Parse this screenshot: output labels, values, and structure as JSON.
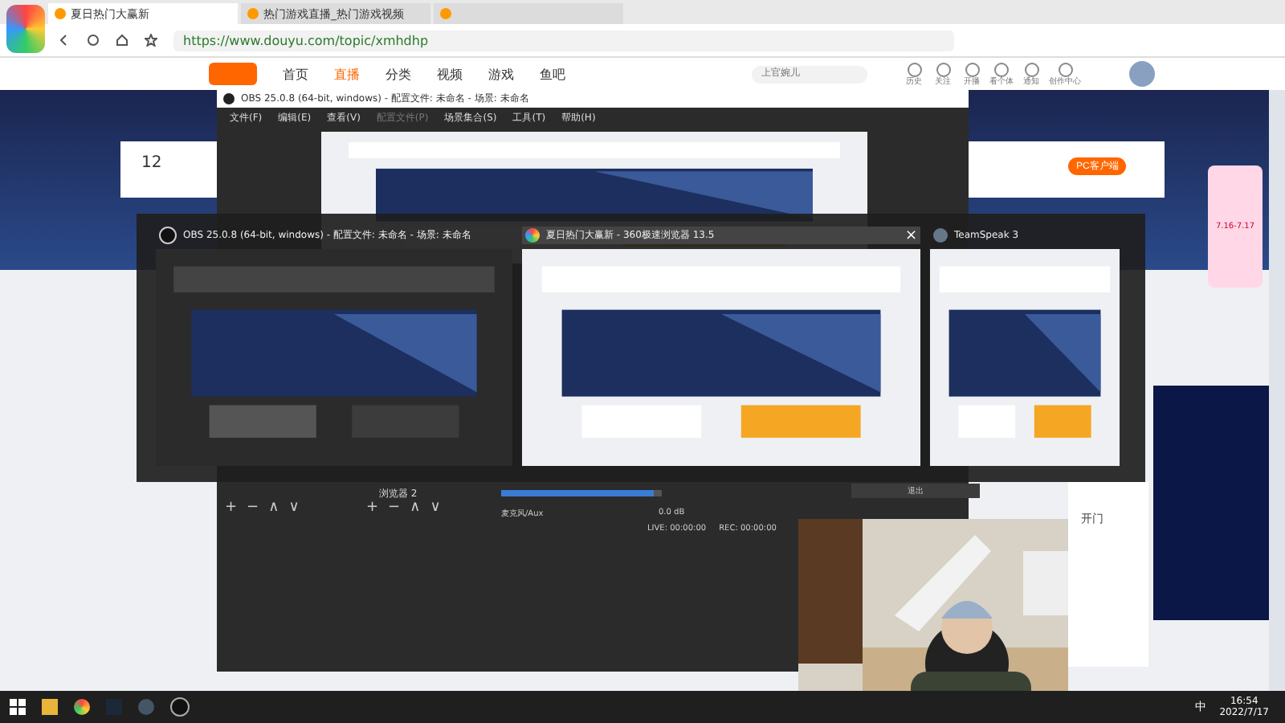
{
  "browser": {
    "tabs": [
      {
        "title": "夏日热门大赢新",
        "selected": true
      },
      {
        "title": "热门游戏直播_热门游戏视频",
        "selected": false
      },
      {
        "selected": false
      }
    ],
    "address": "https://www.douyu.com/topic/xmhdhp",
    "site_nav": [
      {
        "label": "首页",
        "selected": false
      },
      {
        "label": "直播",
        "selected": true
      },
      {
        "label": "分类",
        "selected": false
      },
      {
        "label": "视频",
        "selected": false
      },
      {
        "label": "游戏",
        "selected": false
      },
      {
        "label": "鱼吧",
        "selected": false
      }
    ],
    "site_search": {
      "placeholder": "上官婉儿"
    },
    "header_icons": [
      {
        "label": "历史"
      },
      {
        "label": "关注"
      },
      {
        "label": "开播"
      },
      {
        "label": "看个体"
      },
      {
        "label": "通知"
      },
      {
        "label": "创作中心"
      }
    ],
    "left_stat": "12",
    "pc_button": "PC客户端",
    "promo": "7.16-7.17",
    "chat_line": "开门"
  },
  "obs": {
    "title": "OBS 25.0.8 (64-bit, windows) - 配置文件: 未命名 - 场景: 未命名",
    "menu": [
      {
        "label": "文件(F)",
        "disabled": false
      },
      {
        "label": "编辑(E)",
        "disabled": false
      },
      {
        "label": "查看(V)",
        "disabled": false
      },
      {
        "label": "配置文件(P)",
        "disabled": true
      },
      {
        "label": "场景集合(S)",
        "disabled": false
      },
      {
        "label": "工具(T)",
        "disabled": false
      },
      {
        "label": "帮助(H)",
        "disabled": false
      }
    ],
    "source": "浏览器 2",
    "scene_controls": [
      "+",
      "−",
      "∧",
      "∨"
    ],
    "source_controls": [
      "+",
      "−",
      "∧",
      "∨"
    ],
    "volume": {
      "level": 0.95
    },
    "mic": "麦克风/Aux",
    "db": "0.0 dB",
    "live": "LIVE: 00:00:00",
    "rec": "REC: 00:00:00",
    "exit": "退出"
  },
  "switcher": [
    {
      "title": "OBS 25.0.8 (64-bit, windows) - 配置文件: 未命名 - 场景: 未命名",
      "kind": "obs",
      "selected": false
    },
    {
      "title": "夏日热门大赢新 - 360极速浏览器 13.5",
      "kind": "browser",
      "selected": true,
      "close": "×"
    },
    {
      "title": "TeamSpeak 3",
      "kind": "teamspeak",
      "selected": false
    }
  ],
  "taskbar": {
    "ime": "中",
    "time": "16:54",
    "date": "2022/7/17"
  }
}
